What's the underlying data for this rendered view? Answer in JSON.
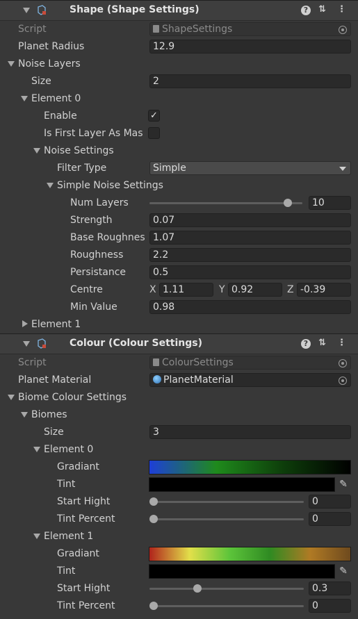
{
  "shape_component": {
    "title": "Shape (Shape Settings)",
    "script_label": "Script",
    "script_value": "ShapeSettings",
    "planet_radius_label": "Planet Radius",
    "planet_radius_value": "12.9",
    "noise_layers_label": "Noise Layers",
    "size_label": "Size",
    "size_value": "2",
    "element0": {
      "label": "Element 0",
      "enable_label": "Enable",
      "enable_checked": true,
      "first_layer_label": "Is First Layer As Mas",
      "first_layer_checked": false,
      "noise_settings_label": "Noise Settings",
      "filter_type_label": "Filter Type",
      "filter_type_value": "Simple",
      "simple_noise_label": "Simple Noise Settings",
      "num_layers_label": "Num Layers",
      "num_layers_value": "10",
      "num_layers_fraction": 0.9,
      "strength_label": "Strength",
      "strength_value": "0.07",
      "base_roughness_label": "Base Roughnes",
      "base_roughness_value": "1.07",
      "roughness_label": "Roughness",
      "roughness_value": "2.2",
      "persistance_label": "Persistance",
      "persistance_value": "0.5",
      "centre_label": "Centre",
      "centre_x_label": "X",
      "centre_x_value": "1.11",
      "centre_y_label": "Y",
      "centre_y_value": "0.92",
      "centre_z_label": "Z",
      "centre_z_value": "-0.39",
      "min_value_label": "Min Value",
      "min_value_value": "0.98"
    },
    "element1_label": "Element 1"
  },
  "colour_component": {
    "title": "Colour (Colour Settings)",
    "script_label": "Script",
    "script_value": "ColourSettings",
    "planet_material_label": "Planet Material",
    "planet_material_value": "PlanetMaterial",
    "biome_settings_label": "Biome Colour Settings",
    "biomes_label": "Biomes",
    "size_label": "Size",
    "size_value": "3",
    "element0": {
      "label": "Element 0",
      "gradiant_label": "Gradiant",
      "gradient_colors": [
        "#1e3fd8",
        "#1f8a1c",
        "#0d3d0a",
        "#000000"
      ],
      "tint_label": "Tint",
      "tint_color": "#000000",
      "start_hight_label": "Start Hight",
      "start_hight_value": "0",
      "start_hight_fraction": 0.0,
      "tint_percent_label": "Tint Percent",
      "tint_percent_value": "0",
      "tint_percent_fraction": 0.0
    },
    "element1": {
      "label": "Element 1",
      "gradiant_label": "Gradiant",
      "gradient_colors": [
        "#b0241c",
        "#e2df4a",
        "#5cc43a",
        "#2f8a22",
        "#b07a24",
        "#6e4a1e"
      ],
      "tint_label": "Tint",
      "tint_color": "#000000",
      "start_hight_label": "Start Hight",
      "start_hight_value": "0.3",
      "start_hight_fraction": 0.3,
      "tint_percent_label": "Tint Percent",
      "tint_percent_value": "0",
      "tint_percent_fraction": 0.0
    }
  },
  "icons": {
    "help": "?",
    "settings": "⇅",
    "more": "⋮",
    "checkmark": "✓",
    "eyedropper": "✎"
  }
}
